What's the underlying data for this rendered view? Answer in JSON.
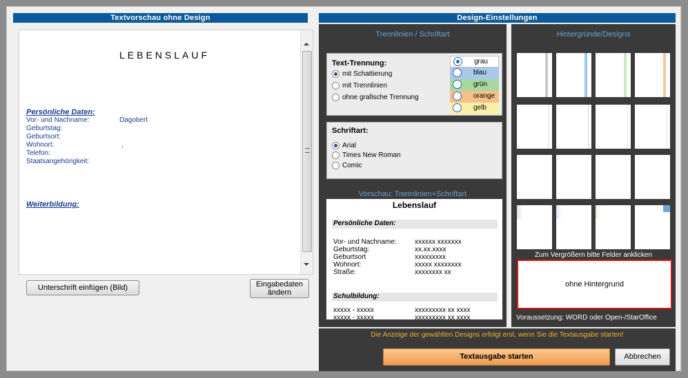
{
  "left": {
    "header": "Textvorschau ohne Design",
    "doc": {
      "title": "LEBENSLAUF",
      "section_personal": "Persönliche Daten:",
      "fields": [
        {
          "label": "Vor- und Nachname:",
          "value": "Dagobert"
        },
        {
          "label": "Geburtstag:",
          "value": ""
        },
        {
          "label": "Geburtsort:",
          "value": ""
        },
        {
          "label": "Wohnort:",
          "value": ","
        },
        {
          "label": "Telefon:",
          "value": ""
        },
        {
          "label": "Staatsangehörigkeit:",
          "value": ""
        }
      ],
      "section_training": "Weiterbildung:"
    },
    "signature_button": "Unterschrift einfügen (Bild)",
    "edit_button_line1": "Eingabedaten",
    "edit_button_line2": "ändern"
  },
  "right": {
    "header": "Design-Einstellungen",
    "lines_fonts_title": "Trennlinien / Schriftart",
    "text_separation": {
      "title": "Text-Trennung:",
      "options": [
        "mit Schattierung",
        "mit Trennlinien",
        "ohne grafische Trennung"
      ],
      "selected": 0
    },
    "colors": {
      "options": [
        {
          "label": "grau",
          "bg": "#ffffff"
        },
        {
          "label": "blau",
          "bg": "#aac8e8"
        },
        {
          "label": "grün",
          "bg": "#a8d8a0"
        },
        {
          "label": "orange",
          "bg": "#f4c088"
        },
        {
          "label": "gelb",
          "bg": "#f8f0a8"
        }
      ],
      "selected": 0
    },
    "font": {
      "title": "Schriftart:",
      "options": [
        "Arial",
        "Times New Roman",
        "Comic"
      ],
      "selected": 0
    },
    "preview": {
      "title": "Vorschau: Trennlinien+Schriftart",
      "doc_title": "Lebenslauf",
      "section_personal": "Persönliche Daten:",
      "rows": [
        {
          "label": "Vor- und Nachname:",
          "value": "xxxxxx xxxxxxx"
        },
        {
          "label": "Geburtstag:",
          "value": "xx.xx.xxxx"
        },
        {
          "label": "Geburtsort",
          "value": "xxxxxxxxx"
        },
        {
          "label": "Wohnort:",
          "value": "xxxxx xxxxxxxx"
        },
        {
          "label": "Straße:",
          "value": "xxxxxxxx xx"
        }
      ],
      "section_school": "Schulbildung:",
      "school_rows": [
        {
          "label": "xxxxx - xxxxx",
          "value": "xxxxxxxxx xx xxxx"
        },
        {
          "label": "xxxxx - xxxxx",
          "value": "xxxxxxxxx xx xxxx"
        }
      ]
    },
    "backgrounds_title": "Hintergründe/Designs",
    "enlarge_hint": "Zum Vergrößern bitte Felder anklicken",
    "selected_background": "ohne Hintergrund",
    "requirement": "Voraussetzung: WORD oder Open-/StarOffice",
    "notice": "Die Anzeige der gewählten Designs erfolgt erst, wenn Sie die Textausgabe starten!",
    "start_button": "Textausgabe starten",
    "cancel_button": "Abbrechen"
  },
  "accent": "#0a5a9b"
}
